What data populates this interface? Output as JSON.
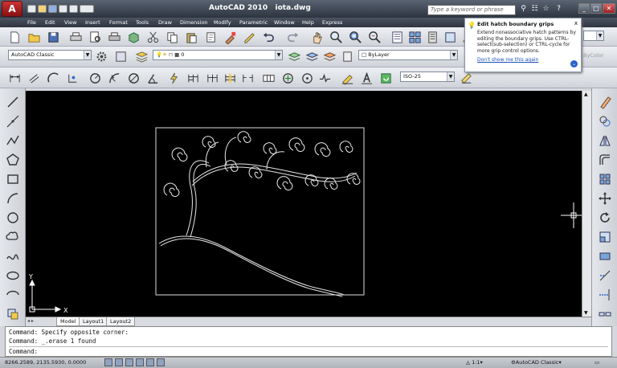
{
  "app": {
    "title": "AutoCAD 2010",
    "file": "iota.dwg",
    "logo": "A"
  },
  "search": {
    "placeholder": "Type a keyword or phrase"
  },
  "menu": [
    "File",
    "Edit",
    "View",
    "Insert",
    "Format",
    "Tools",
    "Draw",
    "Dimension",
    "Modify",
    "Parametric",
    "Window",
    "Help",
    "Express"
  ],
  "toolbar": {
    "workspace": "AutoCAD Classic",
    "layer": "0",
    "color": "ByLayer",
    "color_right": "ByColor",
    "dimstyle": "ISO-25"
  },
  "tooltip": {
    "title": "Edit hatch boundary grips",
    "body": "Extend nonassociative hatch patterns by editing the boundary grips. Use CTRL-select(sub-selection) or CTRL-cycle for more grip control options.",
    "link": "Don't show me this again"
  },
  "tabs": [
    "Model",
    "Layout1",
    "Layout2"
  ],
  "ucs": {
    "x_label": "X",
    "y_label": "Y"
  },
  "command": {
    "line1": "Command: Specify opposite corner:",
    "line2": "Command: _.erase 1 found",
    "line3": "Command:"
  },
  "status": {
    "coords": "8266.2589, 2135.5930, 0.0000",
    "scale": "1:1",
    "workspace": "AutoCAD Classic"
  },
  "colors": {
    "canvas": "#000000",
    "drawing": "#ffffff",
    "title_bg": "#3a4250"
  }
}
